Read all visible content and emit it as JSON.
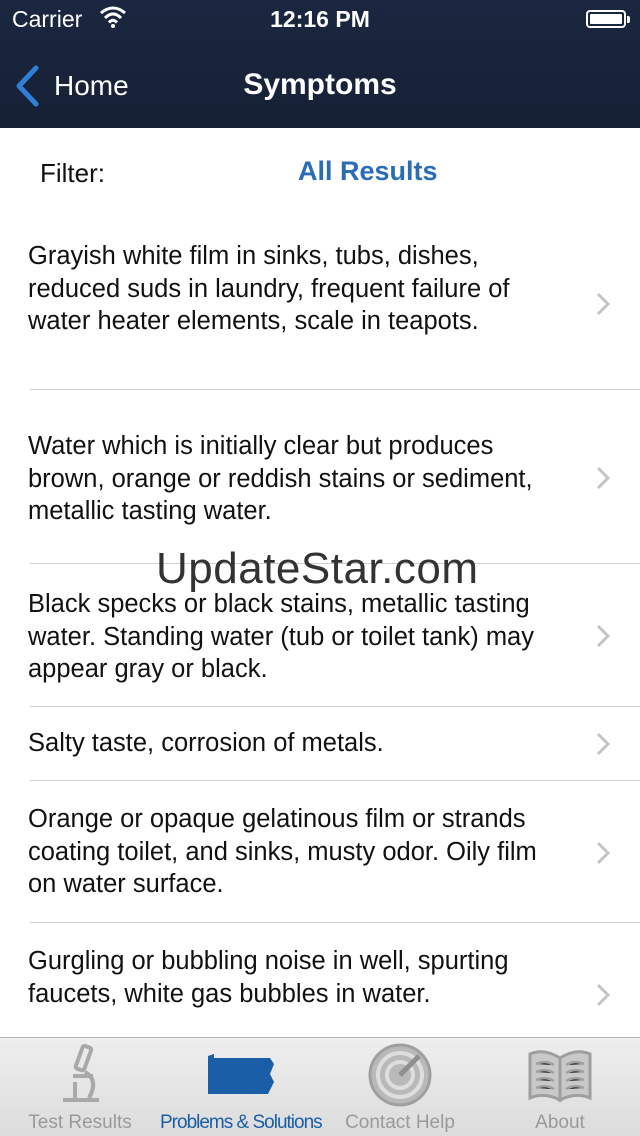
{
  "status_bar": {
    "carrier": "Carrier",
    "time": "12:16 PM"
  },
  "nav": {
    "back_label": "Home",
    "title": "Symptoms"
  },
  "filter": {
    "label": "Filter:",
    "value": "All Results"
  },
  "symptoms": [
    {
      "text": "Grayish white film in sinks, tubs, dishes, reduced suds in laundry, frequent failure of water heater elements, scale in teapots."
    },
    {
      "text": "Water which is initially clear but produces brown, orange or reddish stains or sediment, metallic tasting water."
    },
    {
      "text": "Black specks or black stains, metallic tasting water.  Standing water (tub or toilet tank) may appear gray or black."
    },
    {
      "text": "Salty taste, corrosion of metals."
    },
    {
      "text": "Orange or opaque gelatinous film or strands coating toilet, and sinks, musty odor. Oily film on water surface."
    },
    {
      "text": "Gurgling or bubbling noise in well, spurting faucets, white gas bubbles in water."
    }
  ],
  "watermark": "UpdateStar.com",
  "tabs": [
    {
      "label": "Test Results",
      "icon": "microscope-icon",
      "active": false
    },
    {
      "label": "Problems & Solutions",
      "icon": "pennsylvania-map-icon",
      "active": true
    },
    {
      "label": "Contact Help",
      "icon": "radar-icon",
      "active": false
    },
    {
      "label": "About",
      "icon": "book-icon",
      "active": false
    }
  ],
  "colors": {
    "nav_bg": "#1b2740",
    "accent": "#2a6db4",
    "tab_active": "#1a5ea8"
  }
}
